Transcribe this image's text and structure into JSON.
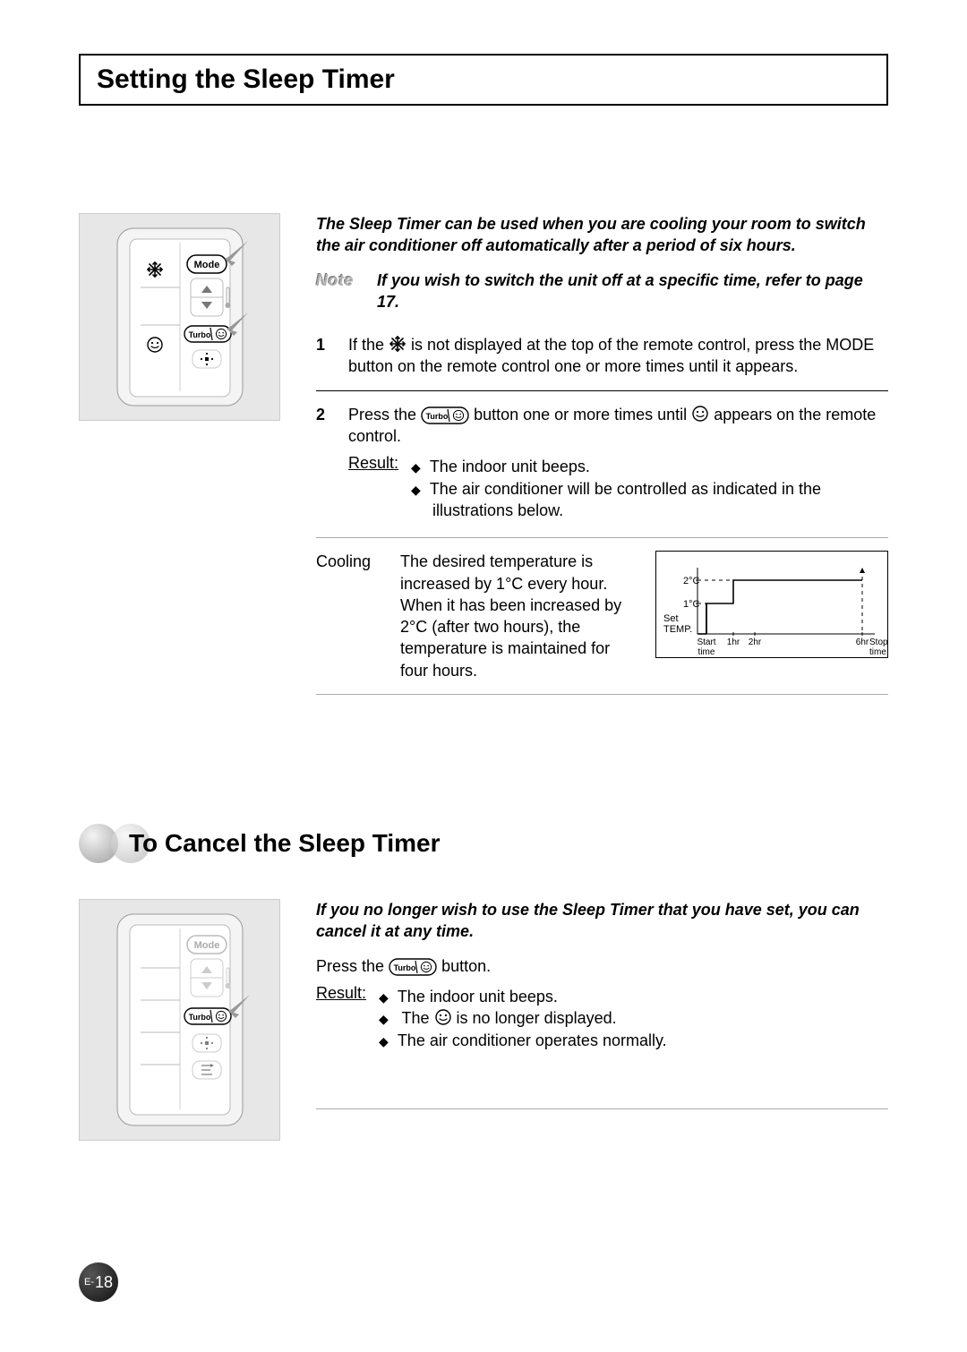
{
  "title": "Setting the Sleep Timer",
  "intro": "The Sleep Timer can be used when you are cooling your room to switch the air conditioner off automatically after a period of six hours.",
  "note_label": "Note",
  "note_text": "If you wish to switch the unit off at a specific time, refer to page 17.",
  "steps": {
    "s1_num": "1",
    "s1_a": "If the ",
    "s1_b": " is not displayed at the top of the remote control, press the MODE button on the remote control one or more times until it appears.",
    "s2_num": "2",
    "s2_a": "Press the ",
    "s2_b": " button one or more times until ",
    "s2_c": " appears on the remote control.",
    "result_label": "Result:",
    "s2_r1": "The indoor unit beeps.",
    "s2_r2": "The air conditioner will be controlled as indicated in the illustrations below."
  },
  "cooling": {
    "label": "Cooling",
    "text": "The desired temperature is increased by 1°C every hour. When it has been increased by 2°C (after two hours), the temperature is maintained for four hours."
  },
  "chart_data": {
    "type": "line",
    "title": "",
    "xlabel": "",
    "ylabel": "Set TEMP.",
    "x_ticks": [
      "Start time",
      "1hr",
      "2hr",
      "6hr"
    ],
    "y_ticks": [
      "1°C",
      "2°C"
    ],
    "annotations": {
      "start": "Start time",
      "stop": "Stop time"
    },
    "series": [
      {
        "name": "temp-offset",
        "x": [
          0,
          1,
          2,
          6
        ],
        "values": [
          0,
          1,
          2,
          2
        ]
      }
    ],
    "xlim": [
      0,
      6
    ],
    "ylim": [
      0,
      2
    ]
  },
  "sub_title": "To Cancel the Sleep Timer",
  "cancel": {
    "intro": "If you no longer wish to use the Sleep Timer that you have set, you can cancel it at any time.",
    "press_a": "Press the ",
    "press_b": " button.",
    "result_label": "Result:",
    "r1": "The indoor unit beeps.",
    "r2_a": "The ",
    "r2_b": " is no longer displayed.",
    "r3": "The air conditioner operates normally."
  },
  "remote": {
    "mode_label": "Mode",
    "turbo_label": "Turbo"
  },
  "page_num_prefix": "E-",
  "page_num": "18",
  "icons": {
    "snowflake": "snowflake-icon",
    "sleep": "sleep-icon",
    "turbo_btn": "turbo-sleep-button-icon"
  }
}
